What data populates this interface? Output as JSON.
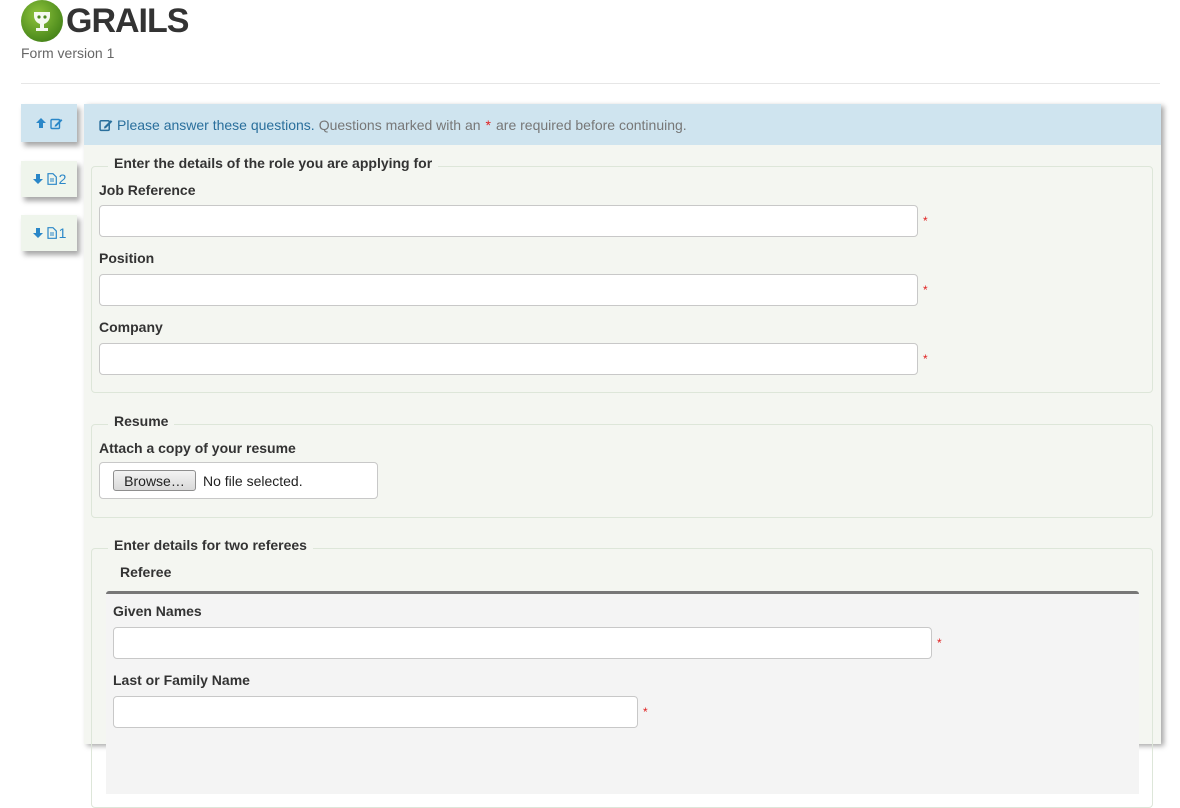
{
  "header": {
    "logo_text": "GRAILS",
    "subtitle": "Form version 1"
  },
  "side_tabs": [
    {
      "icon": "arrow-up-icon",
      "icon2": "edit-icon",
      "label": ""
    },
    {
      "icon": "arrow-down-icon",
      "icon2": "document-icon",
      "label": "2"
    },
    {
      "icon": "arrow-down-icon",
      "icon2": "document-icon",
      "label": "1"
    }
  ],
  "info": {
    "lead": "Please answer these questions.",
    "text_before": "Questions marked with an",
    "star": "*",
    "text_after": "are required before continuing."
  },
  "role_section": {
    "legend": "Enter the details of the role you are applying for",
    "fields": [
      {
        "label": "Job Reference",
        "value": "",
        "required": "*"
      },
      {
        "label": "Position",
        "value": "",
        "required": "*"
      },
      {
        "label": "Company",
        "value": "",
        "required": "*"
      }
    ]
  },
  "resume_section": {
    "legend": "Resume",
    "label": "Attach a copy of your resume",
    "browse_label": "Browse…",
    "file_status": "No file selected."
  },
  "referees_section": {
    "legend": "Enter details for two referees",
    "sub_legend": "Referee",
    "fields": [
      {
        "label": "Given Names",
        "value": "",
        "required": "*"
      },
      {
        "label": "Last or Family Name",
        "value": "",
        "required": "*"
      }
    ]
  },
  "colors": {
    "accent": "#2a87c8",
    "info_bg": "#cfe4ef",
    "panel_bg": "#f4f6f1",
    "required": "#e02020"
  }
}
